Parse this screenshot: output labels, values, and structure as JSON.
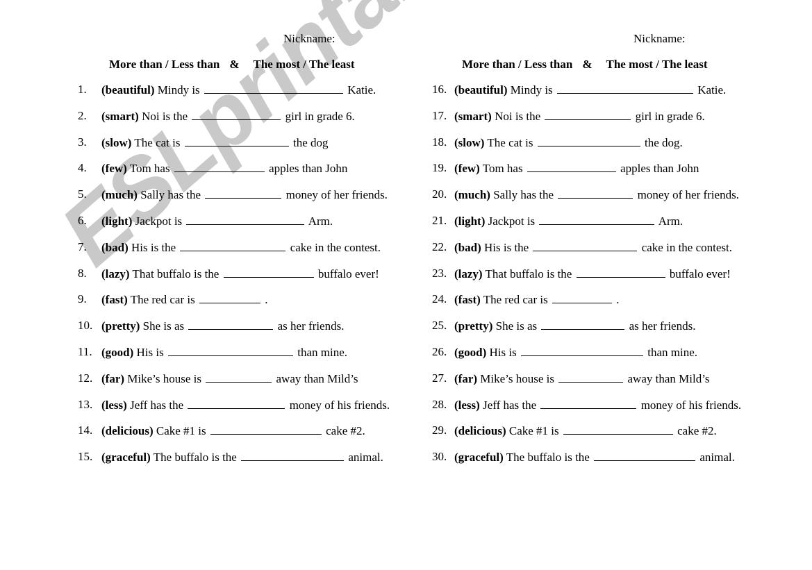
{
  "watermark": {
    "text": "ESLprintables.com",
    "color": "#c9c9c9"
  },
  "columns": [
    {
      "id": "left",
      "nickname_label": "Nickname:",
      "title_part1": "More than / Less than",
      "title_amp": "&",
      "title_part2": "The most / The least",
      "items": [
        {
          "num": "1.",
          "cue": "(beautiful)",
          "pre": "Mindy is",
          "blank": 200,
          "post": "Katie."
        },
        {
          "num": "2.",
          "cue": "(smart)",
          "pre": "Noi is the",
          "blank": 128,
          "post": "girl in grade 6."
        },
        {
          "num": "3.",
          "cue": "(slow)",
          "pre": "The cat is",
          "blank": 150,
          "post": "the dog"
        },
        {
          "num": "4.",
          "cue": "(few)",
          "pre": "Tom has",
          "blank": 130,
          "post": "apples than John"
        },
        {
          "num": "5.",
          "cue": "(much)",
          "pre": "Sally has the",
          "blank": 110,
          "post": "money of her friends."
        },
        {
          "num": "6.",
          "cue": "(light)",
          "pre": "Jackpot is",
          "blank": 170,
          "post": "Arm."
        },
        {
          "num": "7.",
          "cue": "(bad)",
          "pre": "His is the",
          "blank": 152,
          "post": "cake in the contest."
        },
        {
          "num": "8.",
          "cue": "(lazy)",
          "pre": "That buffalo is the",
          "blank": 130,
          "post": "buffalo ever!"
        },
        {
          "num": "9.",
          "cue": "(fast)",
          "pre": "The red car is",
          "blank": 88,
          "post": "."
        },
        {
          "num": "10.",
          "cue": "(pretty)",
          "pre": "She is as",
          "blank": 122,
          "post": "as her friends."
        },
        {
          "num": "11.",
          "cue": "(good)",
          "pre": "His is",
          "blank": 180,
          "post": "than mine."
        },
        {
          "num": "12.",
          "cue": "(far)",
          "pre": "Mike’s house is",
          "blank": 95,
          "post": "away than Mild’s"
        },
        {
          "num": "13.",
          "cue": "(less)",
          "pre": "Jeff has the",
          "blank": 140,
          "post": "money of his friends."
        },
        {
          "num": "14.",
          "cue": "(delicious)",
          "pre": "Cake #1  is",
          "blank": 160,
          "post": "cake #2."
        },
        {
          "num": "15.",
          "cue": "(graceful)",
          "pre": "The buffalo is the",
          "blank": 148,
          "post": "animal."
        }
      ]
    },
    {
      "id": "right",
      "nickname_label": "Nickname:",
      "title_part1": "More than / Less than",
      "title_amp": "&",
      "title_part2": "The most / The least",
      "items": [
        {
          "num": "16.",
          "cue": "(beautiful)",
          "pre": "Mindy is",
          "blank": 196,
          "post": "Katie."
        },
        {
          "num": "17.",
          "cue": "(smart)",
          "pre": "Noi is the",
          "blank": 124,
          "post": "girl in grade 6."
        },
        {
          "num": "18.",
          "cue": "(slow)",
          "pre": "The cat is",
          "blank": 148,
          "post": "the dog."
        },
        {
          "num": "19.",
          "cue": "(few)",
          "pre": "Tom has",
          "blank": 128,
          "post": "apples than John"
        },
        {
          "num": "20.",
          "cue": "(much)",
          "pre": "Sally has the",
          "blank": 108,
          "post": "money of her friends."
        },
        {
          "num": "21.",
          "cue": "(light)",
          "pre": "Jackpot is",
          "blank": 166,
          "post": "Arm."
        },
        {
          "num": "22.",
          "cue": "(bad)",
          "pre": "His is the",
          "blank": 150,
          "post": "cake in the contest."
        },
        {
          "num": "23.",
          "cue": "(lazy)",
          "pre": "That buffalo is the",
          "blank": 128,
          "post": "buffalo ever!"
        },
        {
          "num": "24.",
          "cue": "(fast)",
          "pre": "The red car is",
          "blank": 86,
          "post": "."
        },
        {
          "num": "25.",
          "cue": "(pretty)",
          "pre": "She is as",
          "blank": 120,
          "post": "as her friends."
        },
        {
          "num": "26.",
          "cue": "(good)",
          "pre": "His is",
          "blank": 176,
          "post": "than mine."
        },
        {
          "num": "27.",
          "cue": "(far)",
          "pre": "Mike’s house is",
          "blank": 93,
          "post": "away than Mild’s"
        },
        {
          "num": "28.",
          "cue": "(less)",
          "pre": "Jeff has the",
          "blank": 138,
          "post": "money of his friends."
        },
        {
          "num": "29.",
          "cue": "(delicious)",
          "pre": "Cake #1 is",
          "blank": 158,
          "post": "cake #2."
        },
        {
          "num": "30.",
          "cue": "(graceful)",
          "pre": "The buffalo is the",
          "blank": 146,
          "post": "animal."
        }
      ]
    }
  ]
}
